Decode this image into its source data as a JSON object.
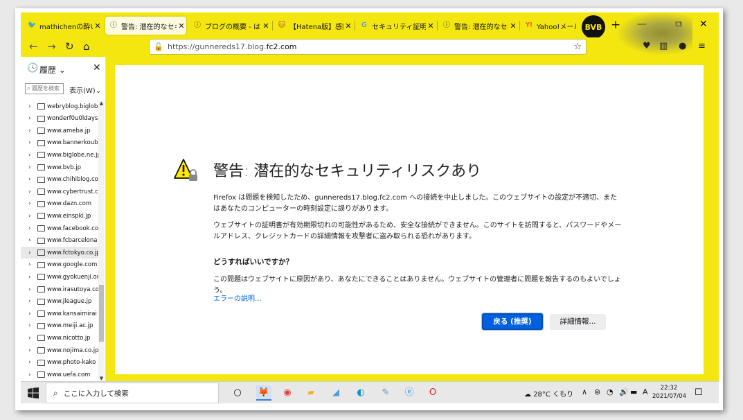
{
  "tabs": [
    {
      "icon": "red-bird-favicon",
      "glyph": "🐦",
      "color": "#d21f2b",
      "title": "mathichenの酔いどれ",
      "active": false
    },
    {
      "icon": "info-circle-favicon",
      "glyph": "ⓘ",
      "color": "#333333",
      "title": "警告: 潜在的なセキュ",
      "active": true
    },
    {
      "icon": "info-circle-favicon",
      "glyph": "ⓘ",
      "color": "#333333",
      "title": "ブログの概要 - はてな",
      "active": false
    },
    {
      "icon": "hatena-favicon",
      "glyph": "🐱",
      "color": "#b5562c",
      "title": "【Hatena版】感動の",
      "active": false
    },
    {
      "icon": "google-favicon",
      "glyph": "G",
      "color": "#4285f4",
      "title": "セキュリティ証明書 有",
      "active": false
    },
    {
      "icon": "info-circle-favicon",
      "glyph": "ⓘ",
      "color": "#333333",
      "title": "警告: 潜在的なセキュ",
      "active": false
    },
    {
      "icon": "yahoo-mail-favicon",
      "glyph": "Y!",
      "color": "#ff0033",
      "title": "Yahoo!メール",
      "active": false
    }
  ],
  "tab_close": "✕",
  "profile_badge": "BVB",
  "new_tab": "+",
  "nav": {
    "back": "←",
    "forward": "→",
    "reload": "↻",
    "home": "⌂",
    "url_prefix": "https://gunnereds17.blog.",
    "url_domain": "fc2.com",
    "star": "☆",
    "right_icons": [
      "pocket-icon",
      "sidebar-icon",
      "account-icon",
      "menu-icon"
    ],
    "right_glyphs": [
      "♥",
      "▥",
      "●",
      "≡"
    ]
  },
  "sidebar": {
    "title": "履歴",
    "search_placeholder": "履歴を検索",
    "view_label": "表示(W)",
    "items": [
      "webryblog.biglobe",
      "wonderf0u0ldays",
      "www.ameba.jp",
      "www.bannerkoubou",
      "www.biglobe.ne.jp",
      "www.bvb.jp",
      "www.chihiblog.com",
      "www.cybertrust.co",
      "www.dazn.com",
      "www.einspki.jp",
      "www.facebook.com",
      "www.fcbarcelona",
      "www.fctokyo.co.jp",
      "www.google.com",
      "www.gyokuenji.or",
      "www.irasutoya.com",
      "www.jleague.jp",
      "www.kansaimirai",
      "www.meiji.ac.jp",
      "www.nicotto.jp",
      "www.nojima.co.jp",
      "www.photo-kako",
      "www.uefa.com"
    ],
    "highlighted_index": 12
  },
  "error_page": {
    "title": "警告: 潜在的なセキュリティリスクあり",
    "para1": "Firefox は問題を検知したため、gunnereds17.blog.fc2.com への接続を中止しました。このウェブサイトの設定が不適切、またはあなたのコンピューターの時刻設定に誤りがあります。",
    "para2": "ウェブサイトの証明書が有効期限切れの可能性があるため、安全な接続ができません。このサイトを訪問すると、パスワードやメールアドレス、クレジットカードの詳細情報を攻撃者に盗み取られる恐れがあります。",
    "question": "どうすればいいですか？",
    "para3": "この問題はウェブサイトに原因があり、あなたにできることはありません。ウェブサイトの管理者に問題を報告するのもよいでしょう。",
    "learn_more": "エラーの説明...",
    "back_button": "戻る (推奨)",
    "advanced_button": "詳細情報..."
  },
  "taskbar": {
    "search_text": "ここに入力して検索",
    "apps": [
      {
        "name": "task-view-icon",
        "glyph": "○",
        "color": "#111111"
      },
      {
        "name": "firefox-icon",
        "glyph": "🦊",
        "color": "#e66000"
      },
      {
        "name": "chrome-icon",
        "glyph": "◉",
        "color": "#db4437"
      },
      {
        "name": "file-explorer-icon",
        "glyph": "▰",
        "color": "#f2b01e"
      },
      {
        "name": "pen-app-icon",
        "glyph": "◢",
        "color": "#4aa0d8"
      },
      {
        "name": "edge-icon",
        "glyph": "◐",
        "color": "#0f8fd4"
      },
      {
        "name": "paint-icon",
        "glyph": "✎",
        "color": "#6a8fd1"
      },
      {
        "name": "internet-explorer-icon",
        "glyph": "ⓔ",
        "color": "#1e90e0"
      },
      {
        "name": "opera-icon",
        "glyph": "O",
        "color": "#e01f2a"
      }
    ],
    "weather": "28°C  くもり",
    "tray_glyphs": [
      "∧",
      "⊜",
      "◔",
      "🔊",
      "▬",
      "A"
    ],
    "time": "22:32",
    "date": "2021/07/04",
    "notify": "☐"
  }
}
